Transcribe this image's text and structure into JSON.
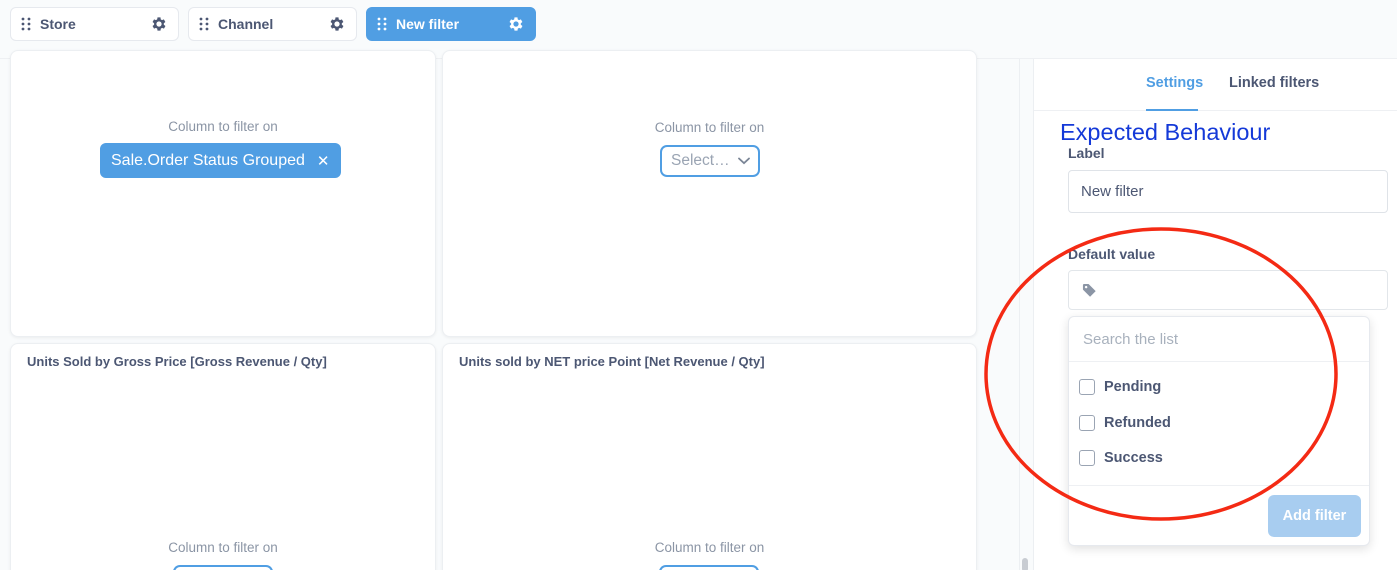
{
  "filters": [
    {
      "label": "Store"
    },
    {
      "label": "Channel"
    },
    {
      "label": "New filter"
    }
  ],
  "cards": {
    "top_left": {
      "column_label": "Column to filter on",
      "selected_column": "Sale.Order Status Grouped"
    },
    "top_right": {
      "column_label": "Column to filter on",
      "select_placeholder": "Select…"
    },
    "bottom_left": {
      "title": "Units Sold by Gross Price [Gross Revenue / Qty]",
      "column_label": "Column to filter on"
    },
    "bottom_right": {
      "title": "Units sold by NET price Point [Net Revenue / Qty]",
      "column_label": "Column to filter on"
    }
  },
  "sidebar": {
    "tabs": [
      {
        "label": "Settings"
      },
      {
        "label": "Linked filters"
      }
    ],
    "annotation": "Expected Behaviour",
    "label_field": {
      "label": "Label",
      "value": "New filter"
    },
    "default_value": {
      "label": "Default value"
    },
    "dropdown": {
      "search_placeholder": "Search the list",
      "options": [
        {
          "label": "Pending"
        },
        {
          "label": "Refunded"
        },
        {
          "label": "Success"
        }
      ],
      "add_button": "Add filter"
    }
  },
  "colors": {
    "accent": "#509ee3",
    "annotation": "#1439d8",
    "highlight_circle": "#f42a14"
  }
}
